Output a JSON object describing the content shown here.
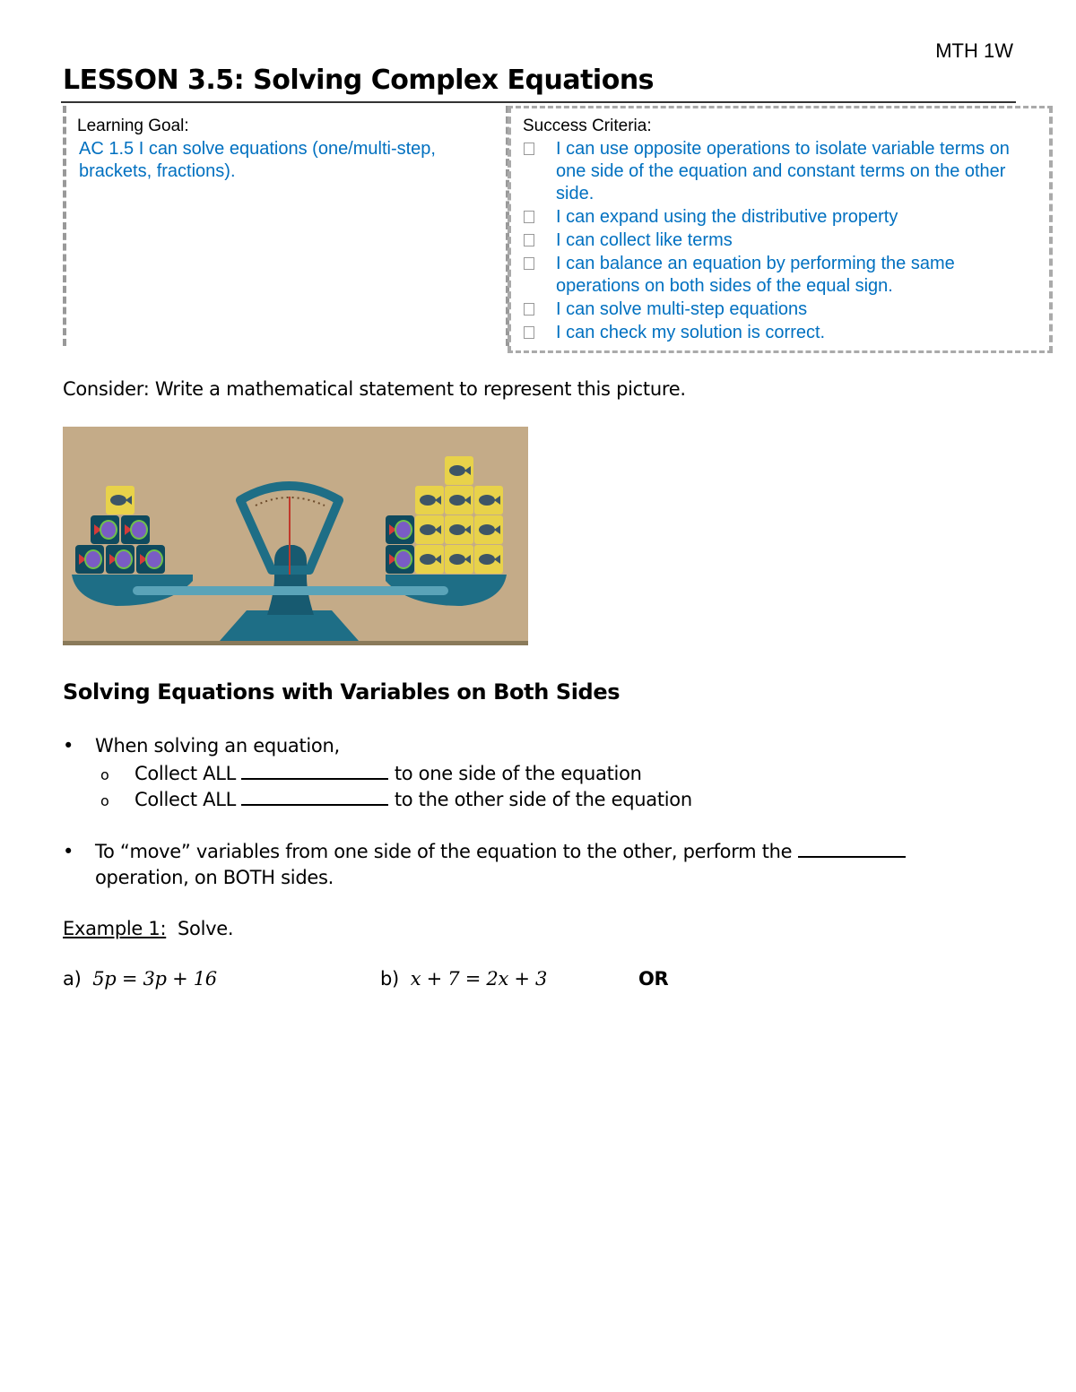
{
  "header": {
    "course_code": "MTH 1W",
    "lesson_title": "LESSON 3.5: Solving Complex Equations"
  },
  "learning_goal": {
    "label": "Learning Goal:",
    "text": "AC 1.5 I can solve equations (one/multi-step, brackets, fractions)."
  },
  "success_criteria": {
    "label": "Success Criteria:",
    "items": [
      {
        "checked": false,
        "text": "I can use opposite operations to isolate variable terms on one side of the equation and constant terms on the other side."
      },
      {
        "checked": false,
        "text": "I can expand using the distributive property"
      },
      {
        "checked": false,
        "text": "I can collect like terms"
      },
      {
        "checked": false,
        "text": "I can balance an equation by performing the same operations on both sides of the equal sign."
      },
      {
        "checked": false,
        "text": "I can solve multi-step equations"
      },
      {
        "checked": false,
        "text": "I can check my solution is correct."
      }
    ]
  },
  "consider": {
    "text": "Consider:  Write a mathematical statement to represent this picture."
  },
  "picture": {
    "description": "Balance scale with fish boxes",
    "left_pan": {
      "variable_boxes": 5,
      "unit_boxes": 1
    },
    "right_pan": {
      "variable_boxes": 2,
      "unit_boxes": 10
    },
    "colors": {
      "background": "#c4ab88",
      "scale": "#1e6e86",
      "beam": "#5aa3b8",
      "unit_box": "#e8d24a",
      "needle": "#c0392b"
    }
  },
  "section": {
    "heading": "Solving Equations with Variables on Both Sides",
    "bullet1": "When solving an equation,",
    "sub1_prefix": "Collect ALL",
    "sub1_suffix": "to one side of the equation",
    "sub2_prefix": "Collect ALL",
    "sub2_suffix": "to the other side of the equation",
    "bullet2_line1": "To “move” variables from one side of the equation to the other, perform the",
    "bullet2_line2": "operation, on BOTH sides."
  },
  "example": {
    "label": "Example 1:",
    "instruction": "Solve.",
    "a_label": "a)",
    "a_equation": "5p = 3p + 16",
    "b_label": "b)",
    "b_equation": "x + 7 = 2x + 3",
    "or_label": "OR"
  }
}
